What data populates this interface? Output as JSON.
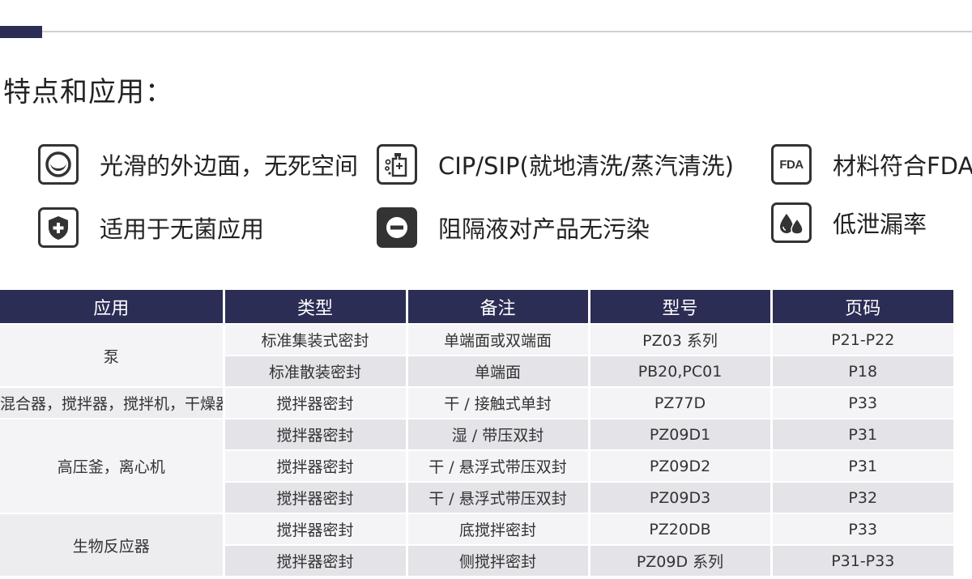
{
  "section_title": "特点和应用：",
  "features": [
    {
      "icon": "smooth-surface-icon",
      "text": "光滑的外边面，无死空间"
    },
    {
      "icon": "cip-sip-icon",
      "text": "CIP/SIP(就地清洗/蒸汽清洗)"
    },
    {
      "icon": "fda-icon",
      "icon_text": "FDA",
      "text": "材料符合FDA"
    },
    {
      "icon": "sterile-shield-icon",
      "text": "适用于无菌应用"
    },
    {
      "icon": "barrier-minus-icon",
      "text": "阻隔液对产品无污染"
    },
    {
      "icon": "low-leak-drops-icon",
      "text": "低泄漏率"
    }
  ],
  "table": {
    "headers": [
      "应用",
      "类型",
      "备注",
      "型号",
      "页码"
    ],
    "groups": [
      {
        "application": "泵",
        "rows": [
          [
            "标准集装式密封",
            "单端面或双端面",
            "PZ03 系列",
            "P21-P22"
          ],
          [
            "标准散装密封",
            "单端面",
            "PB20,PC01",
            "P18"
          ]
        ]
      },
      {
        "application": "混合器，搅拌器，搅拌机，干燥器",
        "rows": [
          [
            "搅拌器密封",
            "干 / 接触式单封",
            "PZ77D",
            "P33"
          ]
        ]
      },
      {
        "application": "高压釜，离心机",
        "rows": [
          [
            "搅拌器密封",
            "湿 / 带压双封",
            "PZ09D1",
            "P31"
          ],
          [
            "搅拌器密封",
            "干 / 悬浮式带压双封",
            "PZ09D2",
            "P31"
          ],
          [
            "搅拌器密封",
            "干 / 悬浮式带压双封",
            "PZ09D3",
            "P32"
          ]
        ]
      },
      {
        "application": "生物反应器",
        "rows": [
          [
            "搅拌器密封",
            "底搅拌密封",
            "PZ20DB",
            "P33"
          ],
          [
            "搅拌器密封",
            "侧搅拌密封",
            "PZ09D 系列",
            "P31-P33"
          ]
        ]
      }
    ]
  },
  "colors": {
    "header_bg": "#2b2d54",
    "accent": "#2b2d54",
    "row_light": "#f4f4f6",
    "row_dark": "#e4e4e8"
  }
}
